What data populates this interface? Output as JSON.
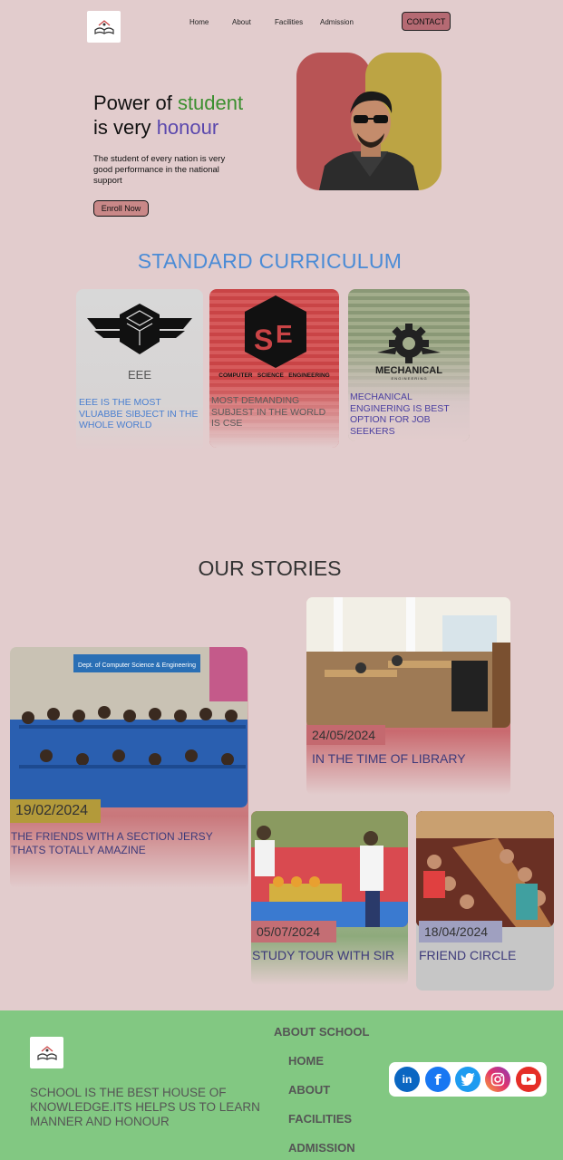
{
  "header": {
    "nav": [
      "Home",
      "About",
      "Facilities",
      "Admission"
    ],
    "contact_label": "CONTACT"
  },
  "hero": {
    "title_line1_prefix": "Power of ",
    "title_line1_highlight": "student",
    "title_line2_prefix": "is very ",
    "title_line2_highlight": "honour",
    "description": "The student of every nation is very good performance in the national support",
    "enroll_label": "Enroll Now"
  },
  "curriculum": {
    "title": "STANDARD CURRICULUM",
    "cards": [
      {
        "logo_text": "EEE",
        "text": "EEE IS THE MOST VLUABBE SIBJECT IN THE WHOLE WORLD",
        "color": "#4a7fd0"
      },
      {
        "logo_text": "COMPUTER   SCIENCE   ENGINEERING",
        "text": "MOST DEMANDING SUBJEST IN THE WORLD IS CSE",
        "color": "#5a5a5a"
      },
      {
        "logo_text": "MECHANICAL",
        "logo_subtext": "E N G I N E E R I N G",
        "text": "MECHANICAL ENGINERING IS BEST OPTION FOR JOB SEEKERS",
        "color": "#4a3fa0"
      }
    ]
  },
  "stories": {
    "title": "OUR STORIES",
    "items": [
      {
        "date": "24/05/2024",
        "caption": "IN THE TIME OF LIBRARY"
      },
      {
        "date": "19/02/2024",
        "caption": "THE FRIENDS WITH A SECTION JERSY THATS TOTALLY AMAZINE",
        "sign": "Dept. of Computer Science & Engineering"
      },
      {
        "date": "05/07/2024",
        "caption": "STUDY TOUR WITH SIR"
      },
      {
        "date": "18/04/2024",
        "caption": "FRIEND CIRCLE"
      }
    ]
  },
  "footer": {
    "description": "SCHOOL IS THE BEST HOUSE OF KNOWLEDGE.ITS HELPS US TO LEARN MANNER AND HONOUR",
    "heading": "ABOUT SCHOOL",
    "links": [
      "HOME",
      "ABOUT",
      "FACILITIES",
      "ADMISSION"
    ],
    "social": [
      "linkedin-icon",
      "facebook-icon",
      "twitter-icon",
      "instagram-icon",
      "youtube-icon"
    ]
  }
}
